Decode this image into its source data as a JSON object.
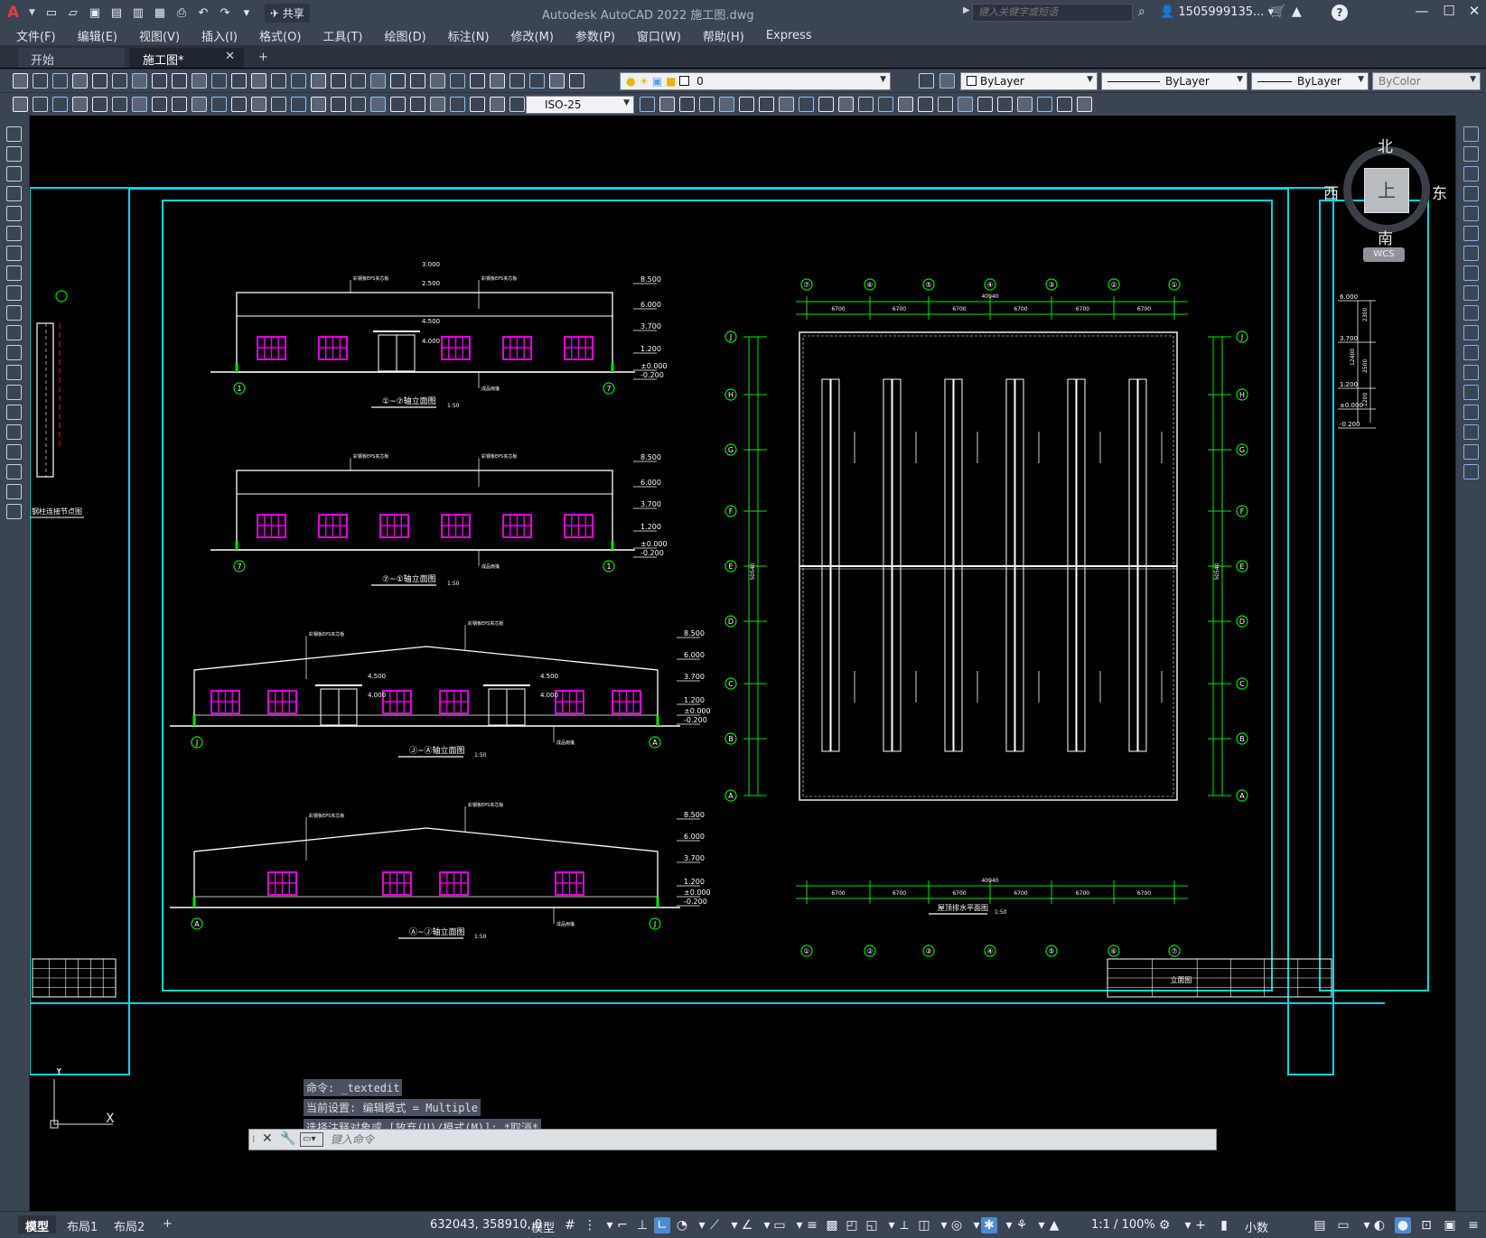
{
  "app": {
    "title": "Autodesk AutoCAD 2022    施工图.dwg",
    "logo": "A",
    "share_label": "共享",
    "search_placeholder": "键入关键字或短语",
    "user": "1505999135...",
    "window_controls": [
      "—",
      "☐",
      "✕"
    ]
  },
  "menu": [
    "文件(F)",
    "编辑(E)",
    "视图(V)",
    "插入(I)",
    "格式(O)",
    "工具(T)",
    "绘图(D)",
    "标注(N)",
    "修改(M)",
    "参数(P)",
    "窗口(W)",
    "帮助(H)",
    "Express"
  ],
  "file_tabs": {
    "start": "开始",
    "document": "施工图*",
    "add": "+"
  },
  "toolbar": {
    "layer_value": "0",
    "color": "ByLayer",
    "linetype": "ByLayer",
    "lineweight": "ByLayer",
    "plotstyle": "ByColor",
    "dimstyle": "ISO-25"
  },
  "viewcube": {
    "north": "北",
    "south": "南",
    "west": "西",
    "east": "东",
    "top": "上",
    "wcs": "WCS"
  },
  "command": {
    "history": [
      "命令: _textedit",
      "当前设置: 编辑模式 = Multiple",
      "选择注释对象或 [放弃(U)/模式(M)]: *取消*"
    ],
    "placeholder": "键入命令"
  },
  "ucs": {
    "x": "X",
    "y": "Y"
  },
  "status": {
    "layout_tabs": [
      "模型",
      "布局1",
      "布局2",
      "+"
    ],
    "coords": "632043, 358910, 0",
    "model": "模型",
    "scale": "1:1 / 100%",
    "units": "小数"
  },
  "drawing": {
    "elev_titles": [
      "①~⑦轴立面图",
      "⑦~①轴立面图",
      "Ⓙ~Ⓐ轴立面图",
      "Ⓐ~Ⓙ轴立面图"
    ],
    "elev_scale": "1:50",
    "plan_title": "屋顶排水平面图",
    "plan_scale": "1:50",
    "detail_title": "钢柱连接节点图",
    "levels": [
      "8.500",
      "6.000",
      "3.700",
      "1.200",
      "±0.000",
      "-0.200"
    ],
    "ridge_levels": [
      "3.000",
      "2.500",
      "4.500",
      "4.000"
    ],
    "callouts": [
      "彩钢板EPS夹芯板",
      "彩钢板EPS夹芯板",
      "成品雨篷"
    ],
    "plan_top_axes": [
      "⑦",
      "⑥",
      "⑤",
      "④",
      "③",
      "②",
      "①"
    ],
    "plan_bottom_axes": [
      "①",
      "②",
      "③",
      "④",
      "⑤",
      "⑥",
      "⑦"
    ],
    "plan_side_axes": [
      "J",
      "H",
      "G",
      "F",
      "E",
      "D",
      "C",
      "B",
      "A"
    ],
    "plan_bay": "6700",
    "plan_total": "40940",
    "plan_depth": "50540",
    "right_levels": [
      "6.000",
      "3.700",
      "1.200",
      "±0.000",
      "-0.200"
    ],
    "right_dims": [
      "2300",
      "12400",
      "2500",
      "1200"
    ],
    "title_block": "立面图"
  }
}
